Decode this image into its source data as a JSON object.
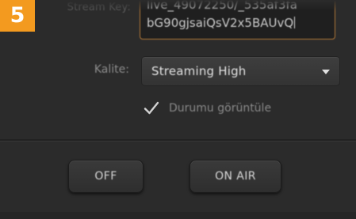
{
  "step_badge": "5",
  "stream_key": {
    "label": "Stream Key:",
    "line1": "live_49072250/_535af3fa",
    "line2": "bG90gjsaiQsV2x5BAUvQ"
  },
  "quality": {
    "label": "Kalite:",
    "value": "Streaming High"
  },
  "status_display": {
    "label": "Durumu görüntüle",
    "checked": true
  },
  "buttons": {
    "off": "OFF",
    "on_air": "ON AIR"
  },
  "colors": {
    "badge": "#f39a1f",
    "field_focus_border": "#b57a39",
    "background": "#2b2b2b"
  }
}
